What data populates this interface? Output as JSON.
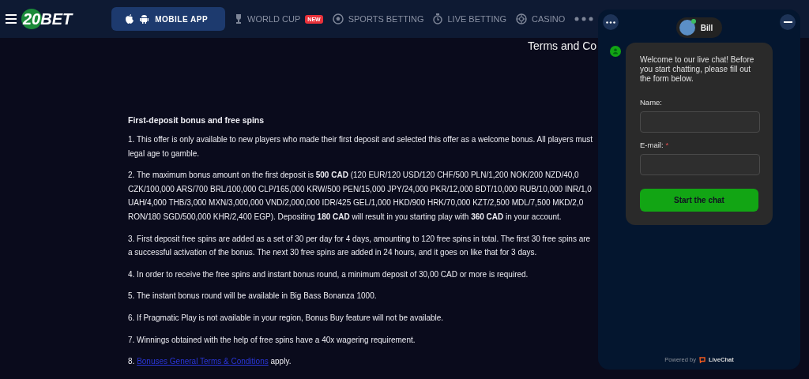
{
  "header": {
    "brand": "20BET",
    "mobile_app": "MOBILE APP",
    "nav": [
      {
        "kind": "trophy",
        "label": "WORLD CUP",
        "badge": "NEW"
      },
      {
        "kind": "ball",
        "label": "SPORTS BETTING"
      },
      {
        "kind": "stopwatch",
        "label": "LIVE BETTING"
      },
      {
        "kind": "roulette",
        "label": "CASINO"
      }
    ]
  },
  "terms": {
    "title": "Terms and Co",
    "heading": "First-deposit bonus and free spins",
    "paragraphs": [
      {
        "lines": [
          "1. This offer is only available to new players who made their first deposit and selected this offer as a welcome bonus. All players must",
          "legal age to gamble."
        ]
      },
      {
        "lines": [
          "2. The maximum bonus amount on the first deposit is **500 CAD** (120 EUR/120 USD/120 CHF/500 PLN/1,200 NOK/200 NZD/40,0",
          "CZK/100,000 ARS/700 BRL/100,000 CLP/165,000 KRW/500 PEN/15,000 JPY/24,000 PKR/12,000 BDT/10,000 RUB/10,000 INR/1,0",
          "UAH/4,000 THB/3,000 MXN/3,000,000 VND/2,000,000 IDR/425 GEL/1,000 HKD/900 HRK/70,000 KZT/2,500 MDL/7,500 MKD/2,0",
          "RON/180 SGD/500,000 KHR/2,400 EGP). Depositing **180 CAD** will result in you starting play with **360 CAD** in your account."
        ]
      },
      {
        "lines": [
          "3. First deposit free spins are added as a set of 30 per day for 4 days, amounting to 120 free spins in total. The first 30 free spins are",
          "a successful activation of the bonus. The next 30 free spins are added in 24 hours, and it goes on like that for 3 days."
        ]
      },
      {
        "lines": [
          "4. In order to receive the free spins and instant bonus round, a minimum deposit of 30,00 CAD or more is required."
        ]
      },
      {
        "lines": [
          "5. The instant bonus round will be available in Big Bass Bonanza 1000."
        ]
      },
      {
        "lines": [
          "6. If Pragmatic Play is not available in your region, Bonus Buy feature will not be available."
        ]
      },
      {
        "lines": [
          "7. Winnings obtained with the help of free spins have a 40x wagering requirement."
        ]
      }
    ],
    "link_paragraph": {
      "before": "8.",
      "link": "Bonuses General Terms & Conditions",
      "after": "apply."
    }
  },
  "chat": {
    "agent": {
      "name": "Bill",
      "online": true
    },
    "welcome": "Welcome to our live chat! Before you start chatting, please fill out the form below.",
    "fields": [
      {
        "label": "Name:"
      },
      {
        "label": "E-mail:",
        "required_mark": "*"
      }
    ],
    "button": "Start the chat",
    "footer": {
      "prefix": "Powered by",
      "brand": "LiveChat"
    }
  }
}
